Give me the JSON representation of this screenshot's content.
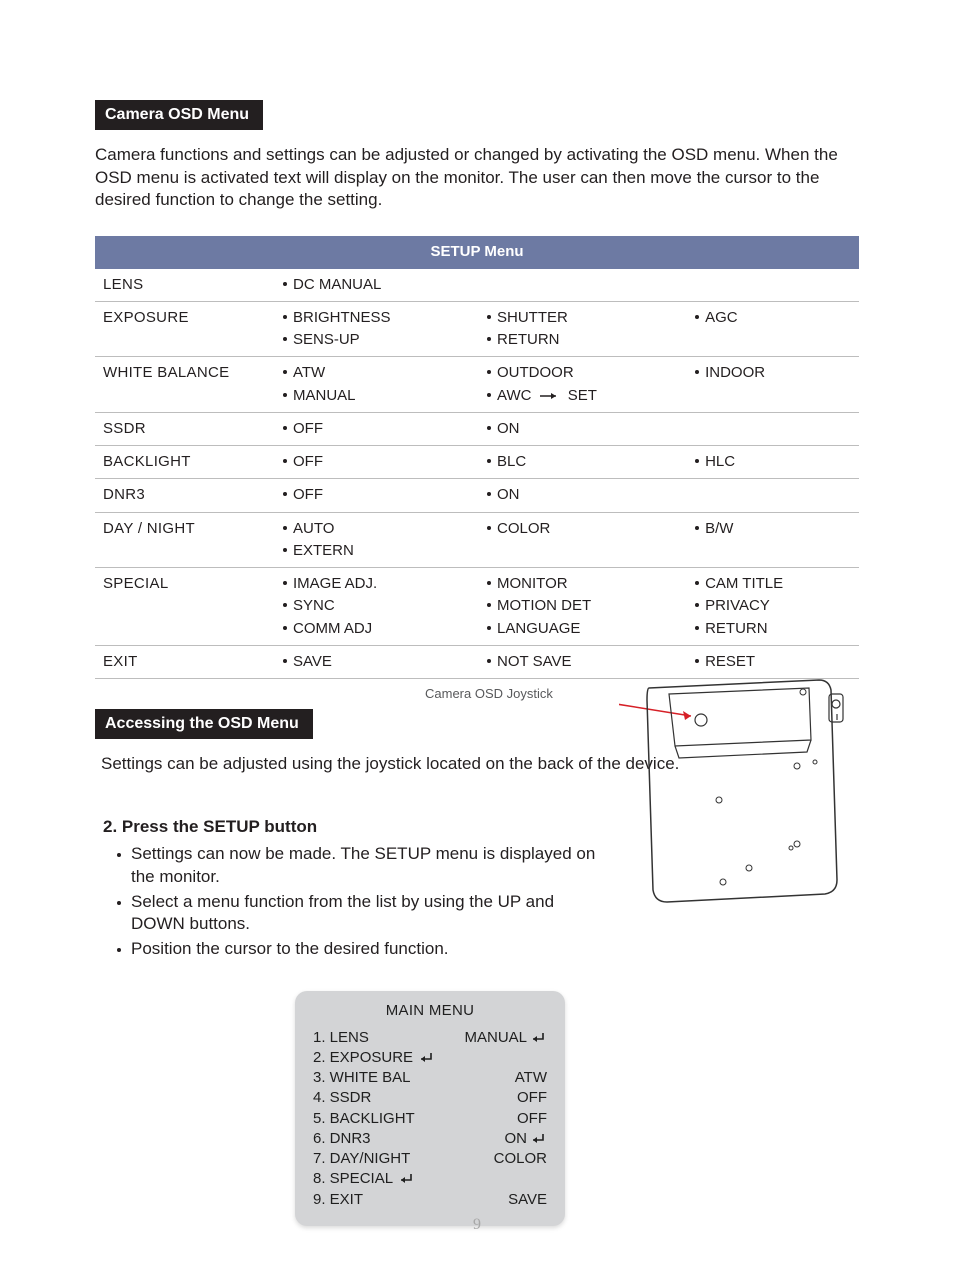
{
  "section1": {
    "heading": "Camera OSD Menu",
    "intro": "Camera functions and settings can be adjusted or changed by activating the OSD menu.  When the OSD menu is activated text will display on the monitor.  The user can then move the cursor to the desired function to change the setting."
  },
  "setup": {
    "title": "SETUP Menu",
    "rows": [
      {
        "label": "LENS",
        "c1": [
          "DC MANUAL"
        ],
        "c2": [],
        "c3": []
      },
      {
        "label": "EXPOSURE",
        "c1": [
          "BRIGHTNESS",
          "SENS-UP"
        ],
        "c2": [
          "SHUTTER",
          "RETURN"
        ],
        "c3": [
          "AGC"
        ]
      },
      {
        "label": "WHITE BALANCE",
        "c1": [
          "ATW",
          "MANUAL"
        ],
        "c2": [
          "OUTDOOR",
          "AWC → SET"
        ],
        "c3": [
          "INDOOR"
        ],
        "arrow_in_c2_row2": true
      },
      {
        "label": "SSDR",
        "c1": [
          "OFF"
        ],
        "c2": [
          "ON"
        ],
        "c3": []
      },
      {
        "label": "BACKLIGHT",
        "c1": [
          "OFF"
        ],
        "c2": [
          "BLC"
        ],
        "c3": [
          "HLC"
        ]
      },
      {
        "label": "DNR3",
        "c1": [
          "OFF"
        ],
        "c2": [
          "ON"
        ],
        "c3": []
      },
      {
        "label": "DAY / NIGHT",
        "c1": [
          "AUTO",
          "EXTERN"
        ],
        "c2": [
          "COLOR"
        ],
        "c3": [
          "B/W"
        ]
      },
      {
        "label": "SPECIAL",
        "c1": [
          "IMAGE ADJ.",
          "SYNC",
          "COMM ADJ"
        ],
        "c2": [
          "MONITOR",
          "MOTION DET",
          "LANGUAGE"
        ],
        "c3": [
          "CAM TITLE",
          "PRIVACY",
          "RETURN"
        ]
      },
      {
        "label": "EXIT",
        "c1": [
          "SAVE"
        ],
        "c2": [
          "NOT SAVE"
        ],
        "c3": [
          "RESET"
        ]
      }
    ]
  },
  "section2": {
    "heading": "Accessing the OSD Menu",
    "intro": "Settings can be adjusted using the joystick located on the back of the device.",
    "joystick_caption": "Camera OSD Joystick"
  },
  "step2": {
    "heading": "2.  Press the SETUP button",
    "bullets": [
      "Settings can now be made.  The SETUP menu is displayed on the monitor.",
      "Select a menu function from the list by using the UP and DOWN buttons.",
      "Position the cursor to the desired function."
    ]
  },
  "osd": {
    "title": "MAIN MENU",
    "items": [
      {
        "n": "1.",
        "label": "LENS",
        "value": "MANUAL",
        "enter": true
      },
      {
        "n": "2.",
        "label": "EXPOSURE",
        "value": "",
        "enter": true
      },
      {
        "n": "3.",
        "label": "WHITE BAL",
        "value": "ATW",
        "enter": false
      },
      {
        "n": "4.",
        "label": "SSDR",
        "value": "OFF",
        "enter": false
      },
      {
        "n": "5.",
        "label": "BACKLIGHT",
        "value": "OFF",
        "enter": false
      },
      {
        "n": "6.",
        "label": "DNR3",
        "value": "ON",
        "enter": true
      },
      {
        "n": "7.",
        "label": "DAY/NIGHT",
        "value": "COLOR",
        "enter": false
      },
      {
        "n": "8.",
        "label": "SPECIAL",
        "value": "",
        "enter": true
      },
      {
        "n": "9.",
        "label": "EXIT",
        "value": "SAVE",
        "enter": false
      }
    ]
  },
  "page_number": "9"
}
